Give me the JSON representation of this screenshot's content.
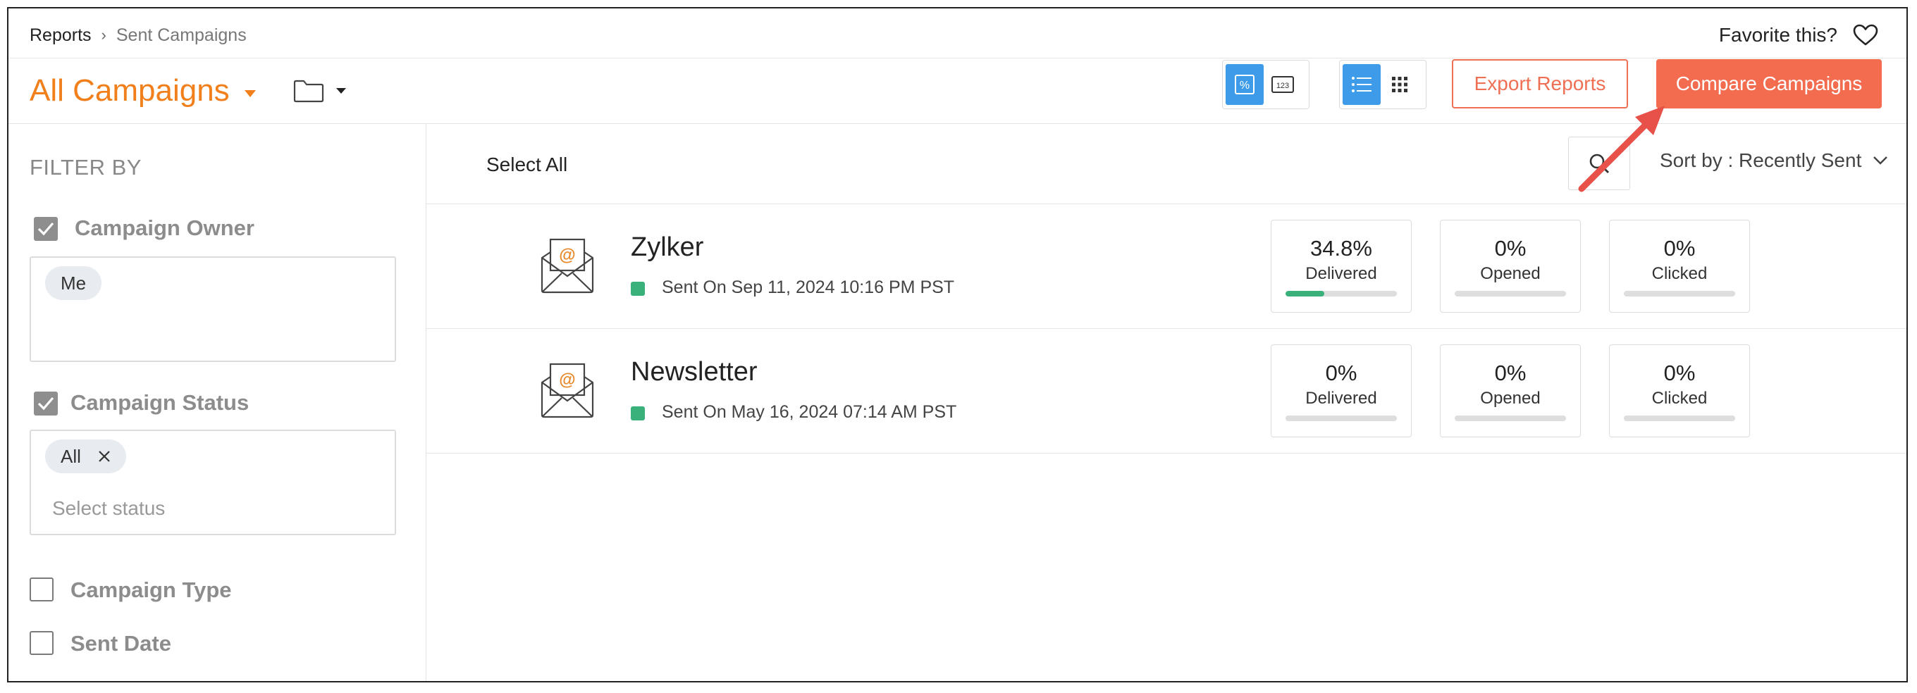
{
  "breadcrumb": {
    "root": "Reports",
    "current": "Sent Campaigns"
  },
  "header": {
    "favorite_label": "Favorite this?",
    "title": "All Campaigns",
    "export_label": "Export Reports",
    "compare_label": "Compare Campaigns",
    "view_toggles": {
      "percent_label": "%",
      "count_label": "123"
    }
  },
  "sidebar": {
    "filter_by": "FILTER BY",
    "filters": [
      {
        "label": "Campaign Owner",
        "checked": true,
        "chips": [
          "Me"
        ]
      },
      {
        "label": "Campaign Status",
        "checked": true,
        "chips": [
          "All"
        ],
        "placeholder": "Select status"
      },
      {
        "label": "Campaign Type",
        "checked": false
      },
      {
        "label": "Sent Date",
        "checked": false
      }
    ]
  },
  "toolbar": {
    "select_all": "Select All",
    "sort_label": "Sort by : Recently Sent"
  },
  "campaigns": [
    {
      "name": "Zylker",
      "sent": "Sent On Sep 11, 2024 10:16 PM PST",
      "stats": [
        {
          "value": "34.8%",
          "label": "Delivered",
          "fraction": 0.348
        },
        {
          "value": "0%",
          "label": "Opened",
          "fraction": 0
        },
        {
          "value": "0%",
          "label": "Clicked",
          "fraction": 0
        }
      ]
    },
    {
      "name": "Newsletter",
      "sent": "Sent On May 16, 2024 07:14 AM PST",
      "stats": [
        {
          "value": "0%",
          "label": "Delivered",
          "fraction": 0
        },
        {
          "value": "0%",
          "label": "Opened",
          "fraction": 0
        },
        {
          "value": "0%",
          "label": "Clicked",
          "fraction": 0
        }
      ]
    }
  ],
  "colors": {
    "accent_orange": "#f07f1c",
    "button_coral": "#f36c4f",
    "toggle_blue": "#3d9be9",
    "status_green": "#3ab07a",
    "annotation_arrow": "#e8504a"
  },
  "icons": [
    "folder-icon",
    "heart-icon",
    "search-icon",
    "list-view-icon",
    "grid-view-icon",
    "envelope-icon",
    "chevron-down-icon",
    "checkmark-icon",
    "remove-chip-icon"
  ]
}
